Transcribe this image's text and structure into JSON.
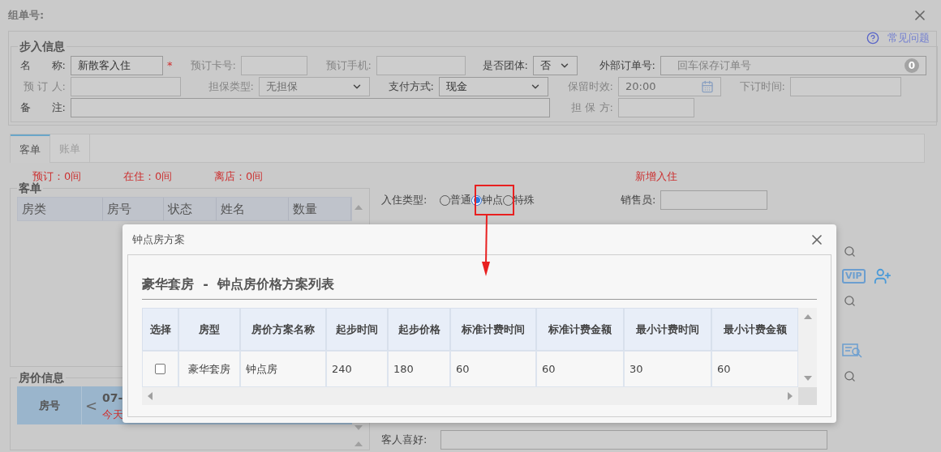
{
  "window": {
    "title": "组单号:"
  },
  "help_link": "常见问题",
  "walk_in": {
    "title": "步入信息",
    "required_mark": "*",
    "fields": [
      {
        "label": "名　　称:",
        "kind": "text",
        "value": "新散客入住",
        "required": true,
        "disabled": false
      },
      {
        "label": "预订卡号:",
        "kind": "text",
        "required": false,
        "disabled": true
      },
      {
        "label": "预订手机:",
        "kind": "text",
        "required": false,
        "disabled": true
      },
      {
        "label": "是否团体:",
        "kind": "select",
        "value": "否",
        "required": false,
        "disabled": false
      },
      {
        "label": "外部订单号:",
        "kind": "text",
        "placeholder": "回车保存订单号",
        "badge": "0",
        "required": false,
        "disabled": false
      },
      {
        "label": "预 订 人:",
        "kind": "text",
        "required": false,
        "disabled": true
      },
      {
        "label": "担保类型:",
        "kind": "select",
        "value": "无担保",
        "required": false,
        "disabled": true
      },
      {
        "label": "支付方式:",
        "kind": "select",
        "value": "现金",
        "required": false,
        "disabled": false
      },
      {
        "label": "保留时效:",
        "kind": "date",
        "value": "20:00",
        "required": false,
        "disabled": true
      },
      {
        "label": "下订时间:",
        "kind": "text",
        "required": false,
        "disabled": true
      },
      {
        "label": "备　　注:",
        "kind": "text",
        "required": false,
        "disabled": false
      },
      {
        "label": "担 保 方:",
        "kind": "text",
        "required": false,
        "disabled": true
      }
    ]
  },
  "tabs": [
    {
      "label": "客单",
      "selected": true
    },
    {
      "label": "账单",
      "selected": false
    }
  ],
  "counts": [
    "预订：0间",
    "在住：0间",
    "离店：0间"
  ],
  "new_checkin_link": "新增入住",
  "guest_list": {
    "title": "客单",
    "columns": [
      "房类",
      "房号",
      "状态",
      "姓名",
      "数量"
    ]
  },
  "checkin_type": {
    "label": "入住类型:",
    "options": [
      {
        "label": "普通",
        "selected": false
      },
      {
        "label": "钟点",
        "selected": true
      },
      {
        "label": "特殊",
        "selected": false
      }
    ]
  },
  "salesperson": {
    "label": "销售员:"
  },
  "vip_badge": "VIP",
  "room_price": {
    "title": "房价信息",
    "room_header": "房号",
    "prev": "<",
    "date": "07-",
    "day": "今天"
  },
  "guest_preference": {
    "label": "客人喜好:"
  },
  "modal": {
    "title": "钟点房方案",
    "heading": "豪华套房  -  钟点房价格方案列表",
    "select_column": "选择",
    "columns": [
      "房型",
      "房价方案名称",
      "起步时间",
      "起步价格",
      "标准计费时间",
      "标准计费金额",
      "最小计费时间",
      "最小计费金额"
    ],
    "rows": [
      {
        "checked": false,
        "cells": [
          "豪华套房",
          "钟点房",
          "240",
          "180",
          "60",
          "60",
          "30",
          "60"
        ]
      }
    ]
  }
}
